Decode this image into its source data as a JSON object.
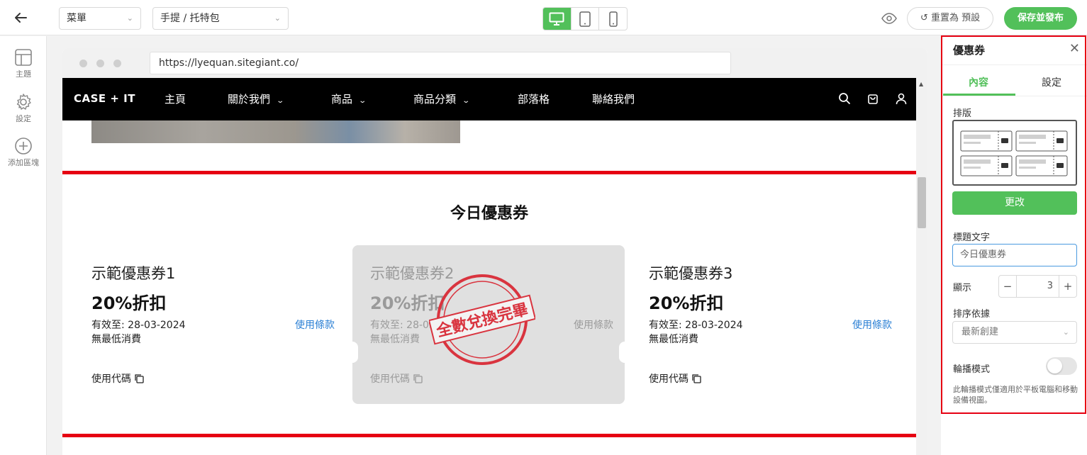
{
  "topbar": {
    "menu_select": "菜單",
    "page_select": "手提 / 托特包",
    "devices": [
      "desktop-icon",
      "tablet-icon",
      "mobile-icon"
    ],
    "active_device": "desktop",
    "reset_label": "重置為 預設",
    "publish_label": "保存並發布"
  },
  "sidebar": {
    "items": [
      {
        "label": "主題",
        "icon": "layout-icon"
      },
      {
        "label": "設定",
        "icon": "gear-icon"
      },
      {
        "label": "添加區塊",
        "icon": "add-circle-icon"
      }
    ]
  },
  "browser": {
    "url": "https://lyequan.sitegiant.co/"
  },
  "site": {
    "logo": "CASE + IT",
    "nav": [
      {
        "label": "主頁",
        "dropdown": false
      },
      {
        "label": "關於我們",
        "dropdown": true
      },
      {
        "label": "商品",
        "dropdown": true
      },
      {
        "label": "商品分類",
        "dropdown": true
      },
      {
        "label": "部落格",
        "dropdown": false
      },
      {
        "label": "聯絡我們",
        "dropdown": false
      }
    ],
    "section_title": "今日優惠券",
    "coupons": [
      {
        "title": "示範優惠券1",
        "amount": "20%折扣",
        "valid": "有效至: 28-03-2024",
        "min_spend": "無最低消費",
        "terms": "使用條款",
        "code": "使用代碼",
        "used": false
      },
      {
        "title": "示範優惠券2",
        "amount": "20%折扣",
        "valid": "有效至: 28-03-2",
        "min_spend": "無最低消費",
        "terms": "使用條款",
        "code": "使用代碼",
        "used": true,
        "stamp": "全數兌換完畢"
      },
      {
        "title": "示範優惠券3",
        "amount": "20%折扣",
        "valid": "有效至: 28-03-2024",
        "min_spend": "無最低消費",
        "terms": "使用條款",
        "code": "使用代碼",
        "used": false
      }
    ]
  },
  "panel": {
    "title": "優惠券",
    "tabs": [
      "內容",
      "設定"
    ],
    "active_tab": "內容",
    "layout_label": "排版",
    "change_label": "更改",
    "title_text_label": "標題文字",
    "title_text_value": "今日優惠券",
    "display_label": "顯示",
    "display_value": "3",
    "sort_label": "排序依據",
    "sort_value": "最新創建",
    "carousel_label": "輪播模式",
    "carousel_enabled": false,
    "carousel_note": "此輪播模式僅適用於平板電腦和移動設備視圖。"
  },
  "colors": {
    "accent": "#52c05a",
    "highlight": "#e60012",
    "link": "#2a7fd4"
  }
}
